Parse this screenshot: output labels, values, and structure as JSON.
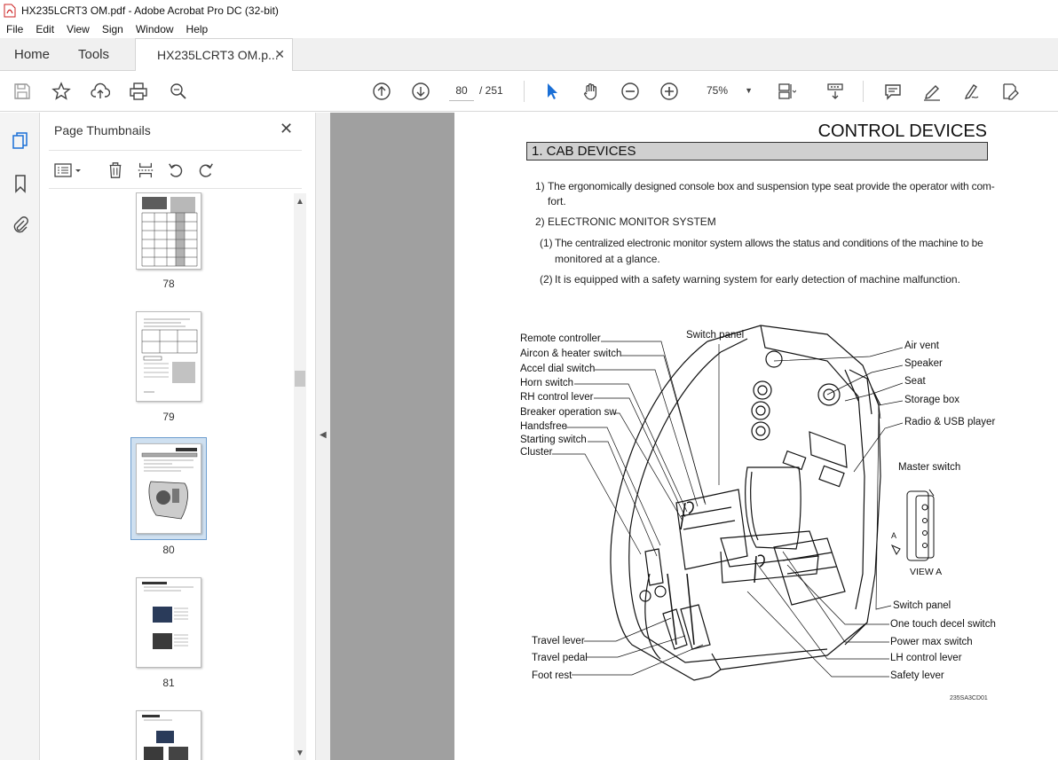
{
  "window": {
    "title": "HX235LCRT3 OM.pdf - Adobe Acrobat Pro DC (32-bit)"
  },
  "menu": [
    "File",
    "Edit",
    "View",
    "Sign",
    "Window",
    "Help"
  ],
  "tabs": {
    "home": "Home",
    "tools": "Tools",
    "document": "HX235LCRT3 OM.p..."
  },
  "toolbar": {
    "current_page": "80",
    "total_pages": "/ 251",
    "zoom": "75%"
  },
  "sidebar_panel": {
    "title": "Page Thumbnails",
    "thumbnails": [
      {
        "page": "78",
        "selected": false
      },
      {
        "page": "79",
        "selected": false
      },
      {
        "page": "80",
        "selected": true
      },
      {
        "page": "81",
        "selected": false
      }
    ]
  },
  "document": {
    "heading": "CONTROL DEVICES",
    "section": "1. CAB DEVICES",
    "item1_num": "1)",
    "item1_text_a": "The ergonomically designed console box and suspension type seat provide the operator with com-",
    "item1_text_b": "fort.",
    "item2_num": "2)",
    "item2_text": "ELECTRONIC MONITOR SYSTEM",
    "sub1_num": "(1)",
    "sub1_text_a": "The centralized electronic monitor system allows the status and conditions of the machine to be",
    "sub1_text_b": "monitored at a glance.",
    "sub2_num": "(2)",
    "sub2_text": "It is equipped with a safety warning system for early detection of machine malfunction.",
    "figure": {
      "left_labels": [
        "Remote controller",
        "Aircon & heater switch",
        "Accel dial switch",
        "Horn switch",
        "RH control lever",
        "Breaker operation sw",
        "Handsfree",
        "Starting switch",
        "Cluster"
      ],
      "top_label": "Switch panel",
      "right_labels": [
        "Air vent",
        "Speaker",
        "Seat",
        "Storage box",
        "Radio & USB player"
      ],
      "master_switch": "Master switch",
      "view_letter": "A",
      "view_label": "VIEW A",
      "bottom_left_labels": [
        "Travel lever",
        "Travel pedal",
        "Foot rest"
      ],
      "bottom_right_labels": [
        "Switch panel",
        "One touch decel switch",
        "Power max switch",
        "LH control lever",
        "Safety lever"
      ],
      "code": "235SA3CD01"
    }
  }
}
